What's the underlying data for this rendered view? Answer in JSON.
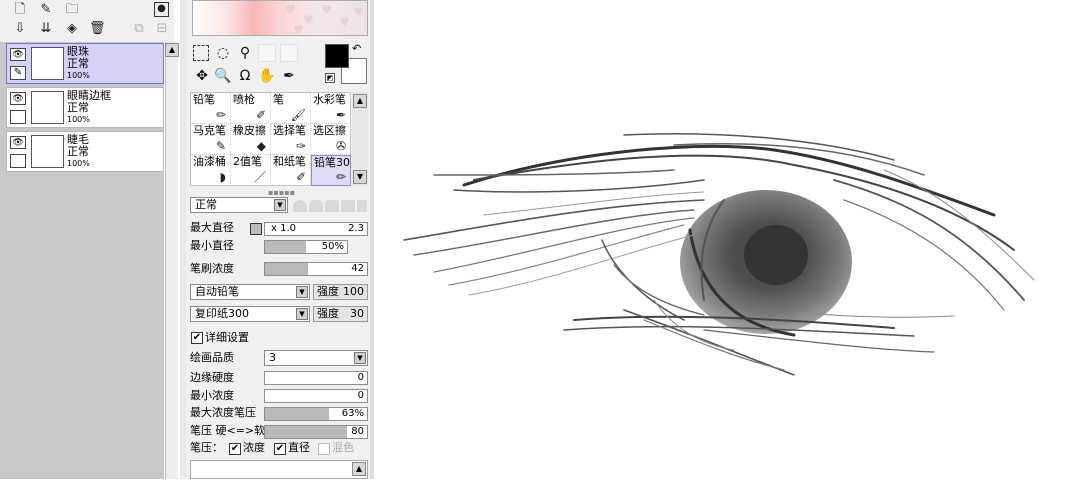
{
  "layer_toolbar": {
    "icons": [
      "new-layer-icon",
      "new-linework-layer-icon",
      "new-folder-icon",
      "canvas-settings-icon",
      "transfer-down-icon",
      "merge-down-icon",
      "clear-layer-icon",
      "delete-layer-icon",
      "lock-layer-icon",
      "apply-selection-icon"
    ]
  },
  "layers": [
    {
      "name": "眼珠",
      "mode": "正常",
      "opacity": "100%",
      "selected": true
    },
    {
      "name": "眼睛边框",
      "mode": "正常",
      "opacity": "100%",
      "selected": false
    },
    {
      "name": "睫毛",
      "mode": "正常",
      "opacity": "100%",
      "selected": false
    }
  ],
  "colors": {
    "foreground": "#000000",
    "background": "#ffffff",
    "selection": "#d3d3f8"
  },
  "tools": [
    {
      "label": "铅笔",
      "icon": "pencil-icon"
    },
    {
      "label": "喷枪",
      "icon": "airbrush-icon"
    },
    {
      "label": "笔",
      "icon": "brush-icon"
    },
    {
      "label": "水彩笔",
      "icon": "watercolor-icon"
    },
    {
      "label": "马克笔",
      "icon": "marker-icon"
    },
    {
      "label": "橡皮擦",
      "icon": "eraser-icon"
    },
    {
      "label": "选择笔",
      "icon": "select-pen-icon"
    },
    {
      "label": "选区擦",
      "icon": "select-eraser-icon"
    },
    {
      "label": "油漆桶",
      "icon": "bucket-icon"
    },
    {
      "label": "2值笔",
      "icon": "binary-pen-icon"
    },
    {
      "label": "和纸笔",
      "icon": "washi-pen-icon"
    },
    {
      "label": "铅笔30",
      "icon": "pencil-icon"
    }
  ],
  "brush": {
    "blend_mode": "正常",
    "max_size_label": "最大直径",
    "max_size_multiplier": "x 1.0",
    "max_size_value": "2.3",
    "min_size_label": "最小直径",
    "min_size_value": "50%",
    "min_size_fraction": 0.5,
    "density_label": "笔刷浓度",
    "density_value": "42",
    "density_fraction": 0.42,
    "shape": "自动铅笔",
    "shape_strength_label": "强度",
    "shape_strength": "100",
    "texture": "复印纸300",
    "texture_strength_label": "强度",
    "texture_strength": "30",
    "advanced_label": "详细设置",
    "quality_label": "绘画品质",
    "quality_value": "3",
    "edge_hardness_label": "边缘硬度",
    "edge_hardness": "0",
    "min_density_label": "最小浓度",
    "min_density": "0",
    "max_pressure_label": "最大浓度笔压",
    "max_pressure": "63%",
    "max_pressure_fraction": 0.63,
    "hard_soft_label": "笔压 硬<=>软",
    "hard_soft": "80",
    "hard_soft_fraction": 0.8,
    "pressure_label": "笔压：",
    "pressure_density": "浓度",
    "pressure_size": "直径",
    "pressure_blend": "混色"
  }
}
